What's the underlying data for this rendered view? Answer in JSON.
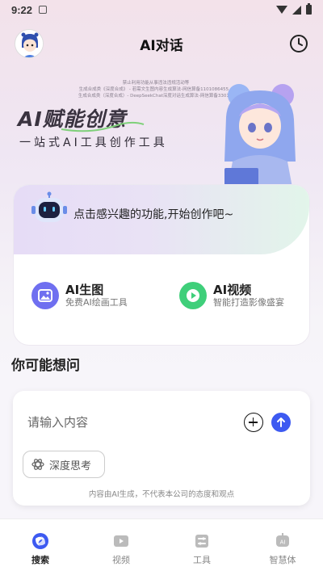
{
  "status_bar": {
    "time": "9:22"
  },
  "header": {
    "title": "AI对话"
  },
  "banner": {
    "fine_print": [
      "禁止利用功能从事违法违规活动等",
      "生成合成类《深度合成》 - 若需文生图内容生成算法-网信算备1101086455...",
      "生成合成类（深度合成）- DeepSeekChat深度对话生成算法-网信算备3301...",
      ""
    ],
    "title": "AI赋能创意",
    "subtitle": "一站式AI工具创作工具"
  },
  "feature_card": {
    "prompt": "点击感兴趣的功能,开始创作吧~",
    "features": [
      {
        "name": "AI生图",
        "desc": "免费AI绘画工具",
        "color": "#6f6ff0"
      },
      {
        "name": "AI视频",
        "desc": "智能打造影像盛宴",
        "color": "#3fcf7a"
      }
    ]
  },
  "section_title": "你可能想问",
  "input_card": {
    "placeholder": "请输入内容",
    "think_label": "深度思考",
    "disclaimer": "内容由AI生成，不代表本公司的态度和观点"
  },
  "bottom_nav": {
    "items": [
      {
        "label": "搜索",
        "icon": "search-swirl-icon",
        "active": true
      },
      {
        "label": "视频",
        "icon": "video-icon",
        "active": false
      },
      {
        "label": "工具",
        "icon": "tools-icon",
        "active": false
      },
      {
        "label": "智慧体",
        "icon": "ai-agent-icon",
        "active": false
      }
    ]
  },
  "colors": {
    "accent": "#3d5af1",
    "green": "#3fcf7a",
    "purple": "#6f6ff0"
  }
}
